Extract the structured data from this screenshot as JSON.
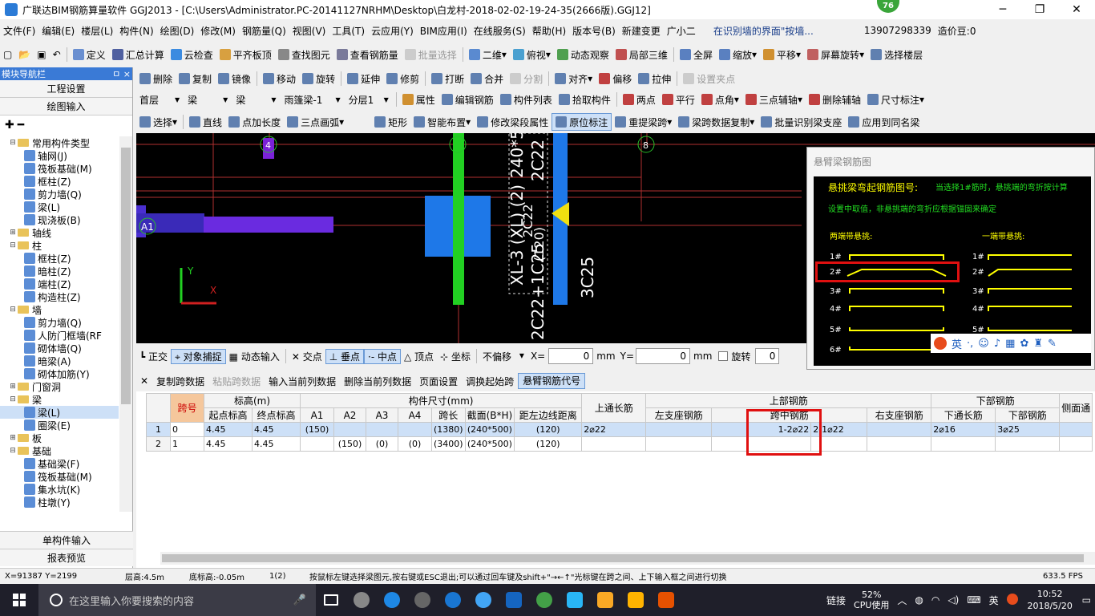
{
  "title": "广联达BIM钢筋算量软件 GGJ2013 - [C:\\Users\\Administrator.PC-20141127NRHM\\Desktop\\白龙村-2018-02-02-19-24-35(2666版).GGJ12]",
  "badge": "76",
  "menu": [
    "文件(F)",
    "编辑(E)",
    "楼层(L)",
    "构件(N)",
    "绘图(D)",
    "修改(M)",
    "钢筋量(Q)",
    "视图(V)",
    "工具(T)",
    "云应用(Y)",
    "BIM应用(I)",
    "在线服务(S)",
    "帮助(H)",
    "版本号(B)",
    "新建变更",
    "广小二"
  ],
  "menu_hint": "在识别墙的界面\"按墙...",
  "phone": "13907298339",
  "price": "造价豆:0",
  "tb1": [
    "定义",
    "汇总计算",
    "云检查",
    "平齐板顶",
    "查找图元",
    "查看钢筋量",
    "批量选择",
    "二维",
    "俯视",
    "动态观察",
    "局部三维",
    "全屏",
    "缩放",
    "平移",
    "屏幕旋转",
    "选择楼层"
  ],
  "tb2": [
    "删除",
    "复制",
    "镜像",
    "移动",
    "旋转",
    "延伸",
    "修剪",
    "打断",
    "合并",
    "分割",
    "对齐",
    "偏移",
    "拉伸",
    "设置夹点"
  ],
  "tb3_dd": [
    "首层",
    "梁",
    "梁",
    "雨篷梁-1",
    "分层1"
  ],
  "tb3": [
    "属性",
    "编辑钢筋",
    "构件列表",
    "拾取构件",
    "两点",
    "平行",
    "点角",
    "三点辅轴",
    "删除辅轴",
    "尺寸标注"
  ],
  "tb4": [
    "选择",
    "直线",
    "点加长度",
    "三点画弧",
    "矩形",
    "智能布置",
    "修改梁段属性",
    "原位标注",
    "重提梁跨",
    "梁跨数据复制",
    "批量识别梁支座",
    "应用到同名梁"
  ],
  "left": {
    "header": "模块导航栏",
    "pin": "ㅁ ×",
    "btn1": "工程设置",
    "btn2": "绘图输入",
    "tree": [
      {
        "t": "常用构件类型",
        "lv": 0,
        "f": 1,
        "e": "⊟"
      },
      {
        "t": "轴网(J)",
        "lv": 1
      },
      {
        "t": "筏板基础(M)",
        "lv": 1
      },
      {
        "t": "框柱(Z)",
        "lv": 1
      },
      {
        "t": "剪力墙(Q)",
        "lv": 1
      },
      {
        "t": "梁(L)",
        "lv": 1
      },
      {
        "t": "现浇板(B)",
        "lv": 1
      },
      {
        "t": "轴线",
        "lv": 0,
        "f": 1,
        "e": "⊞"
      },
      {
        "t": "柱",
        "lv": 0,
        "f": 1,
        "e": "⊟"
      },
      {
        "t": "框柱(Z)",
        "lv": 1
      },
      {
        "t": "暗柱(Z)",
        "lv": 1
      },
      {
        "t": "端柱(Z)",
        "lv": 1
      },
      {
        "t": "构造柱(Z)",
        "lv": 1
      },
      {
        "t": "墙",
        "lv": 0,
        "f": 1,
        "e": "⊟"
      },
      {
        "t": "剪力墙(Q)",
        "lv": 1
      },
      {
        "t": "人防门框墙(RF",
        "lv": 1
      },
      {
        "t": "砌体墙(Q)",
        "lv": 1
      },
      {
        "t": "暗梁(A)",
        "lv": 1
      },
      {
        "t": "砌体加筋(Y)",
        "lv": 1
      },
      {
        "t": "门窗洞",
        "lv": 0,
        "f": 1,
        "e": "⊞"
      },
      {
        "t": "梁",
        "lv": 0,
        "f": 1,
        "e": "⊟"
      },
      {
        "t": "梁(L)",
        "lv": 1,
        "sel": 1
      },
      {
        "t": "圈梁(E)",
        "lv": 1
      },
      {
        "t": "板",
        "lv": 0,
        "f": 1,
        "e": "⊞"
      },
      {
        "t": "基础",
        "lv": 0,
        "f": 1,
        "e": "⊟"
      },
      {
        "t": "基础梁(F)",
        "lv": 1
      },
      {
        "t": "筏板基础(M)",
        "lv": 1
      },
      {
        "t": "集水坑(K)",
        "lv": 1
      },
      {
        "t": "柱墩(Y)",
        "lv": 1
      }
    ],
    "btn3": "单构件输入",
    "btn4": "报表预览"
  },
  "canvas": {
    "axis_a1": "A1",
    "axis_4": "4",
    "axis_8": "8",
    "beam_text1": "XL-3 (XL) (2)",
    "beam_text2": "240*5",
    "beam_text3": "2C22",
    "beam_text4": "2C22+1C25",
    "beam_text5": "3C25",
    "beam_text6": "(120)",
    "beam_text7": "2C22",
    "ucs_y": "Y",
    "ucs_x": "X"
  },
  "popup": {
    "title": "悬臂梁钢筋图",
    "heading": "悬挑梁弯起钢筋图号:",
    "note1": "当选择1#筋时，悬挑端的弯折按计算",
    "note2": "设置中取值，非悬挑端的弯折应根据锚固来确定",
    "left_label": "两端带悬挑:",
    "right_label": "一端带悬挑:",
    "nums": [
      "1#",
      "2#",
      "3#",
      "4#",
      "5#",
      "6#"
    ],
    "ime": [
      "英",
      "·,",
      "☺",
      "♪",
      "▦",
      "✿",
      "♜",
      "✎"
    ]
  },
  "snap": {
    "items": [
      "正交",
      "对象捕捉",
      "动态输入",
      "交点",
      "垂点",
      "中点",
      "顶点",
      "坐标"
    ],
    "offset": "不偏移",
    "x_label": "X=",
    "x": "0",
    "y_label": "Y=",
    "y": "0",
    "mm": "mm",
    "rotate": "旋转",
    "rot": "0"
  },
  "tabletb": [
    "复制跨数据",
    "粘贴跨数据",
    "输入当前列数据",
    "删除当前列数据",
    "页面设置",
    "调换起始跨",
    "悬臂钢筋代号"
  ],
  "table": {
    "h_span": "跨号",
    "h_elev": "标高(m)",
    "h_size": "构件尺寸(mm)",
    "h_top_long": "上通长筋",
    "h_top": "上部钢筋",
    "h_bottom": "下部钢筋",
    "h_side": "侧面通",
    "h_start": "起点标高",
    "h_end": "终点标高",
    "h_a1": "A1",
    "h_a2": "A2",
    "h_a3": "A3",
    "h_a4": "A4",
    "h_len": "跨长",
    "h_sec": "截面(B*H)",
    "h_dist": "距左边线距离",
    "h_left_sup": "左支座钢筋",
    "h_mid": "跨中钢筋",
    "h_right_sup": "右支座钢筋",
    "h_bot_long": "下通长筋",
    "h_bot": "下部钢筋",
    "rows": [
      {
        "n": "1",
        "span": "0",
        "start": "4.45",
        "end": "4.45",
        "a1": "(150)",
        "a2": "",
        "a3": "",
        "a4": "",
        "len": "(1380)",
        "sec": "(240*500)",
        "dist": "(120)",
        "toplong": "2⌀22",
        "left": "",
        "leftsup": "1-2⌀22",
        "mid": "2-1⌀22",
        "right": "",
        "botlong": "2⌀16",
        "bot": "3⌀25"
      },
      {
        "n": "2",
        "span": "1",
        "start": "4.45",
        "end": "4.45",
        "a1": "",
        "a2": "(150)",
        "a3": "(0)",
        "a4": "(0)",
        "len": "(3400)",
        "sec": "(240*500)",
        "dist": "(120)",
        "toplong": "",
        "left": "",
        "leftsup": "",
        "mid": "",
        "right": "",
        "botlong": "",
        "bot": ""
      }
    ]
  },
  "status": {
    "coords": "X=91387 Y=2199",
    "floor": "层高:4.5m",
    "base": "底标高:-0.05m",
    "sel": "1(2)",
    "msg": "按鼠标左键选择梁图元,按右键或ESC退出;可以通过回车键及shift+\"→←↑\"光标键在跨之间、上下输入框之间进行切换",
    "fps": "633.5 FPS"
  },
  "taskbar": {
    "search": "在这里输入你要搜索的内容",
    "link": "链接",
    "cpu": "52%",
    "cpu_label": "CPU使用",
    "lang": "英",
    "time": "10:52",
    "date": "2018/5/20"
  }
}
